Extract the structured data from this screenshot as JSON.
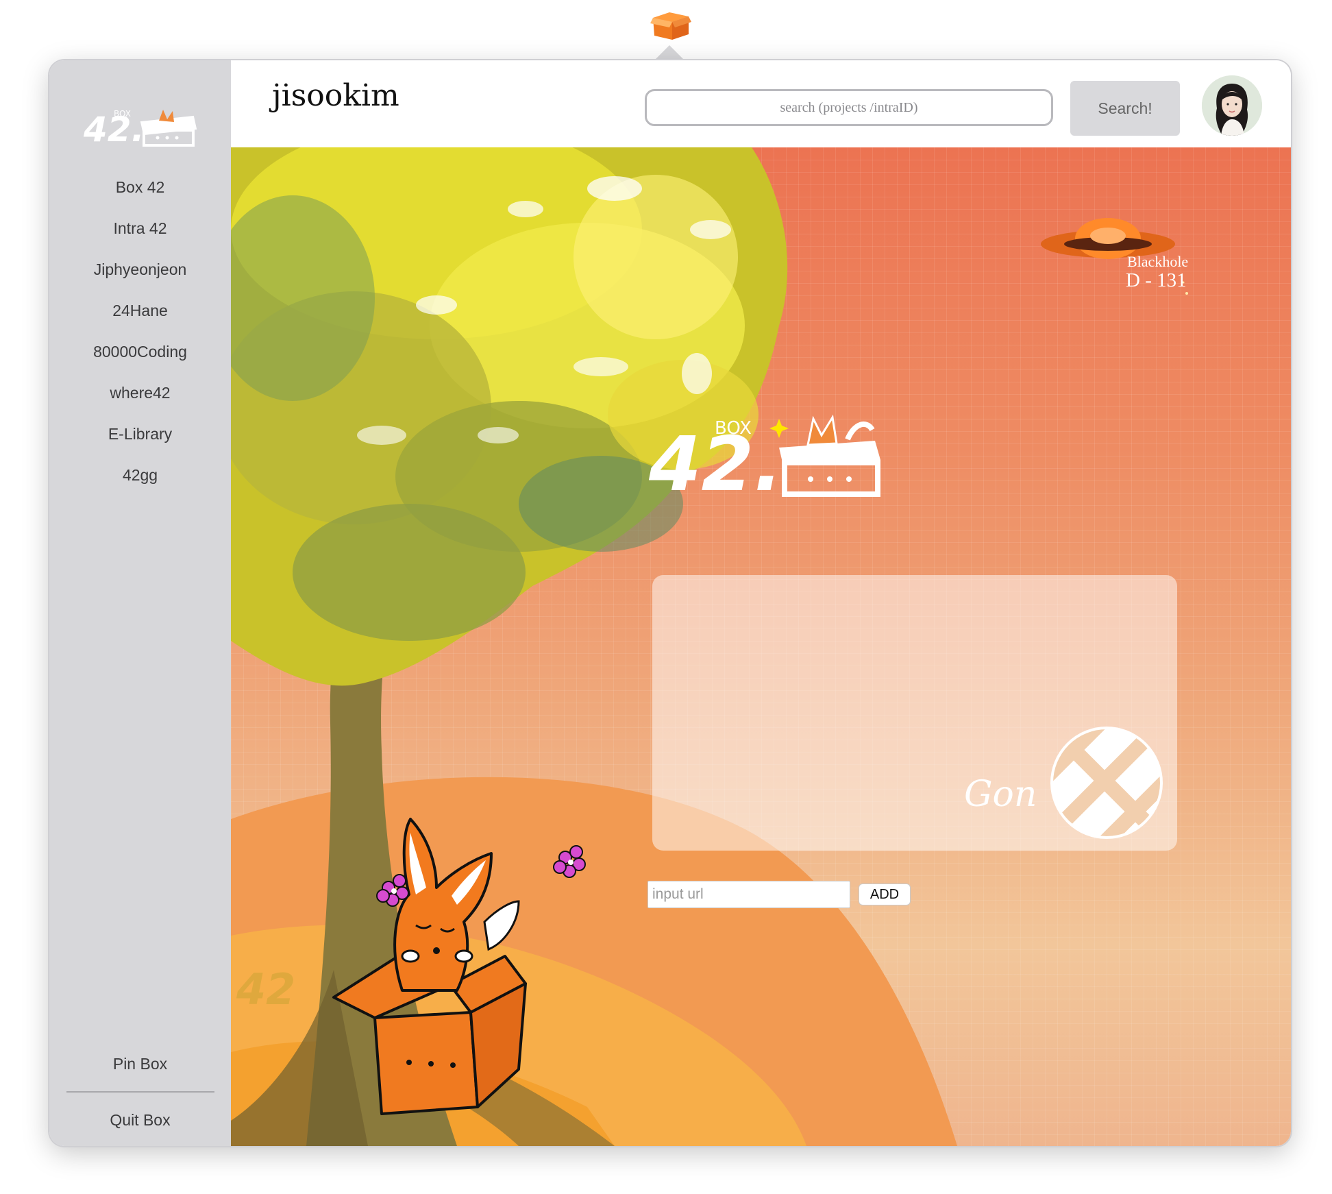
{
  "header": {
    "username": "jisookim",
    "search_placeholder": "search (projects /intraID)",
    "search_button": "Search!"
  },
  "sidebar": {
    "items": [
      {
        "label": "Box 42"
      },
      {
        "label": "Intra 42"
      },
      {
        "label": "Jiphyeonjeon"
      },
      {
        "label": "24Hane"
      },
      {
        "label": "80000Coding"
      },
      {
        "label": "where42"
      },
      {
        "label": "E-Library"
      },
      {
        "label": "42gg"
      }
    ],
    "pin_label": "Pin Box",
    "quit_label": "Quit Box"
  },
  "main": {
    "blackhole_label": "Blackhole",
    "blackhole_count": "D - 131",
    "card_name": "Gon",
    "url_placeholder": "input url",
    "add_button": "ADD"
  },
  "colors": {
    "sidebar_bg": "#d7d7da",
    "accent_orange": "#f08a3a",
    "button_gray": "#d9d9dc"
  }
}
